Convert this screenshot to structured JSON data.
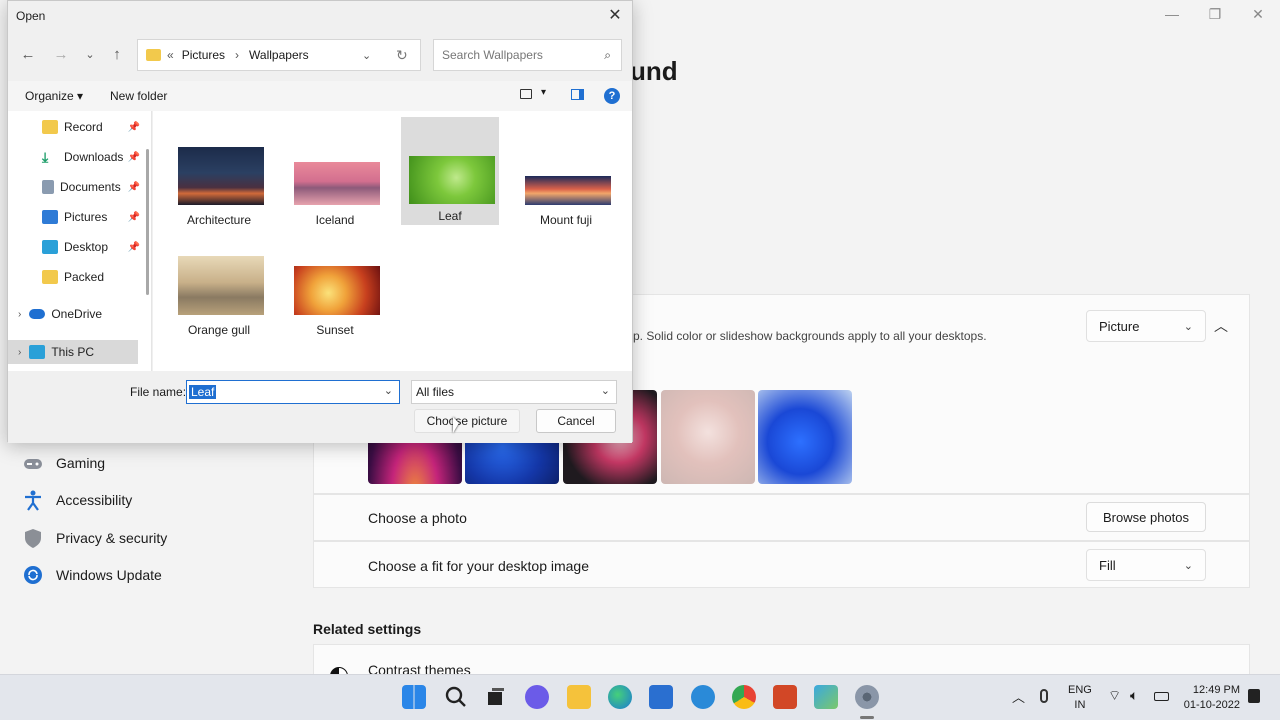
{
  "settings": {
    "title_partial": "und",
    "nav": [
      {
        "label": "Gaming",
        "icon": "gaming-icon"
      },
      {
        "label": "Accessibility",
        "icon": "accessibility-icon"
      },
      {
        "label": "Privacy & security",
        "icon": "shield-icon"
      },
      {
        "label": "Windows Update",
        "icon": "update-icon"
      }
    ],
    "background_desc_partial": "p. Solid color or slideshow backgrounds apply to all your desktops.",
    "background_type": "Picture",
    "choose_photo_label": "Choose a photo",
    "browse_photos_label": "Browse photos",
    "fit_label": "Choose a fit for your desktop image",
    "fit_value": "Fill",
    "related_settings": "Related settings",
    "contrast_themes": "Contrast themes"
  },
  "dialog": {
    "title": "Open",
    "breadcrumb": [
      "Pictures",
      "Wallpapers"
    ],
    "breadcrumb_sep": "›",
    "breadcrumb_prefix": "«",
    "search_placeholder": "Search Wallpapers",
    "organize": "Organize ▾",
    "new_folder": "New folder",
    "tree": [
      {
        "label": "Record",
        "pinned": true
      },
      {
        "label": "Downloads",
        "pinned": true
      },
      {
        "label": "Documents",
        "pinned": true
      },
      {
        "label": "Pictures",
        "pinned": true
      },
      {
        "label": "Desktop",
        "pinned": true
      },
      {
        "label": "Packed",
        "pinned": false
      },
      {
        "label": "OneDrive",
        "pinned": false
      },
      {
        "label": "This PC",
        "pinned": false
      }
    ],
    "files": [
      "Architecture",
      "Iceland",
      "Leaf",
      "Mount fuji",
      "Orange gull",
      "Sunset"
    ],
    "selected_file": "Leaf",
    "file_name_label": "File name:",
    "file_name_value": "Leaf",
    "file_type": "All files",
    "choose_button": "Choose picture",
    "cancel_button": "Cancel"
  },
  "tray": {
    "lang1": "ENG",
    "lang2": "IN",
    "time": "12:49 PM",
    "date": "01-10-2022"
  }
}
